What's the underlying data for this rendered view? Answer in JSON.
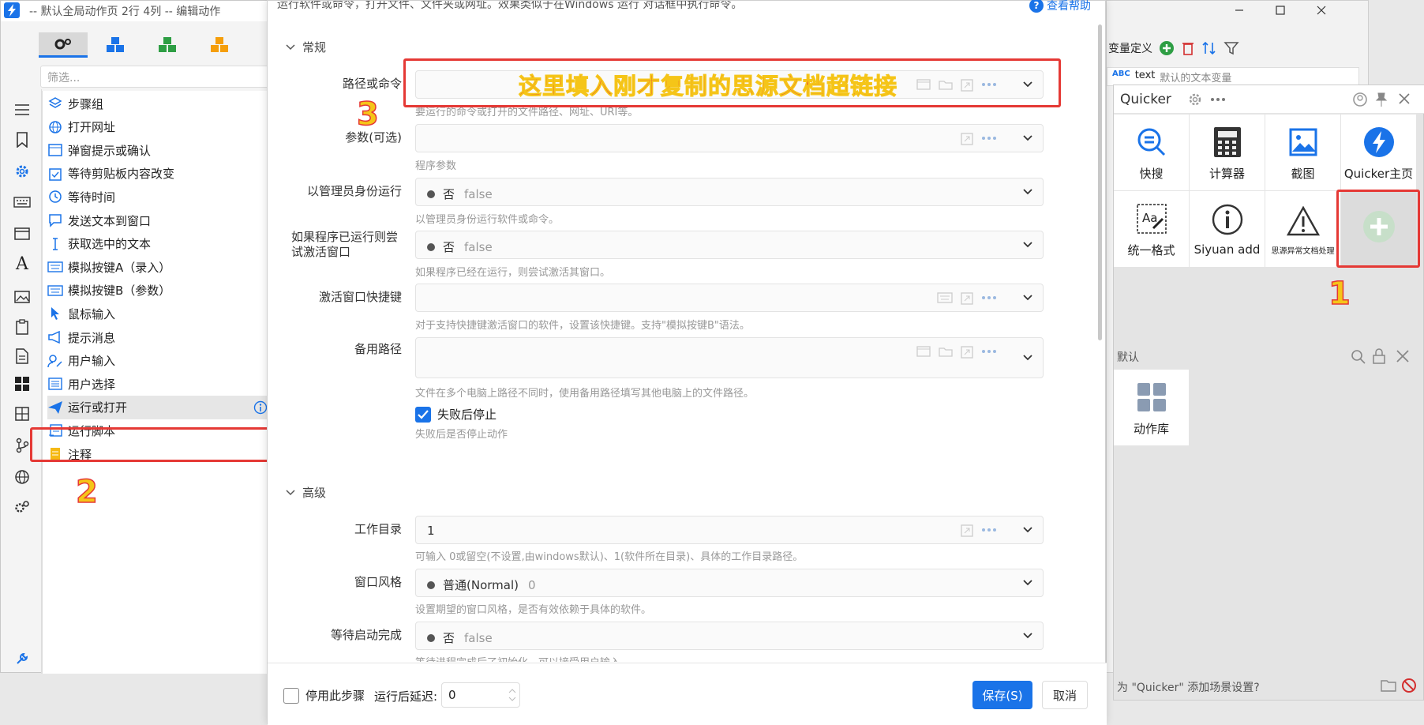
{
  "editor": {
    "title": "-- 默认全局动作页 2行 4列 -- 编辑动作",
    "filter_placeholder": "筛选...",
    "tabs": [
      "gear-icon",
      "cubes-blue-icon",
      "cubes-green-icon",
      "cubes-orange-icon"
    ],
    "steps": [
      {
        "label": "步骤组",
        "icon": "layers-icon"
      },
      {
        "label": "打开网址",
        "icon": "globe-icon"
      },
      {
        "label": "弹窗提示或确认",
        "icon": "dialog-icon"
      },
      {
        "label": "等待剪贴板内容改变",
        "icon": "clipboard-icon"
      },
      {
        "label": "等待时间",
        "icon": "clock-icon"
      },
      {
        "label": "发送文本到窗口",
        "icon": "chat-icon"
      },
      {
        "label": "获取选中的文本",
        "icon": "text-cursor-icon"
      },
      {
        "label": "模拟按键A（录入）",
        "icon": "keyboard-icon"
      },
      {
        "label": "模拟按键B（参数）",
        "icon": "keyboard-icon"
      },
      {
        "label": "鼠标输入",
        "icon": "cursor-icon"
      },
      {
        "label": "提示消息",
        "icon": "megaphone-icon"
      },
      {
        "label": "用户输入",
        "icon": "user-input-icon"
      },
      {
        "label": "用户选择",
        "icon": "list-icon"
      },
      {
        "label": "运行或打开",
        "icon": "send-icon"
      },
      {
        "label": "运行脚本",
        "icon": "script-icon"
      },
      {
        "label": "注释",
        "icon": "note-icon"
      }
    ]
  },
  "dialog": {
    "description": "运行软件或命令，打开文件、文件夹或网址。效果类似于在Windows 运行 对话框中执行命令。",
    "help_link": "查看帮助",
    "section_general": "常规",
    "section_advanced": "高级",
    "fields": {
      "path": {
        "label": "路径或命令",
        "help": "要运行的命令或打开的文件路径、网址、URI等。",
        "value": ""
      },
      "args": {
        "label": "参数(可选)",
        "help": "程序参数",
        "value": ""
      },
      "admin": {
        "label": "以管理员身份运行",
        "value": "否",
        "raw": "false",
        "help": "以管理员身份运行软件或命令。"
      },
      "activate": {
        "label": "如果程序已运行则尝试激活窗口",
        "value": "否",
        "raw": "false",
        "help": "如果程序已经在运行，则尝试激活其窗口。"
      },
      "hotkey": {
        "label": "激活窗口快捷键",
        "help": "对于支持快捷键激活窗口的软件，设置该快捷键。支持\"模拟按键B\"语法。",
        "value": ""
      },
      "altpath": {
        "label": "备用路径",
        "help": "文件在多个电脑上路径不同时，使用备用路径填写其他电脑上的文件路径。",
        "value": ""
      },
      "stop_on_fail": {
        "label": "失败后停止",
        "help": "失败后是否停止动作",
        "checked": true
      },
      "workdir": {
        "label": "工作目录",
        "value": "1",
        "help": "可输入 0或留空(不设置,由windows默认)、1(软件所在目录)、具体的工作目录路径。"
      },
      "winstyle": {
        "label": "窗口风格",
        "value": "普通(Normal)",
        "raw": "0",
        "help": "设置期望的窗口风格，是否有效依赖于具体的软件。"
      },
      "wait": {
        "label": "等待启动完成",
        "value": "否",
        "raw": "false",
        "help": "等待进程完成后了初始化，可以接受用户输入。"
      }
    },
    "footer": {
      "disable_label": "停用此步骤",
      "delay_label": "运行后延迟:",
      "delay_value": "0",
      "save": "保存(S)",
      "cancel": "取消"
    }
  },
  "annotations": {
    "path_hint": "这里填入刚才复制的思源文档超链接",
    "num1": "1",
    "num2": "2",
    "num3": "3"
  },
  "bgwin": {
    "var_def": "变量定义",
    "var_row_type": "ABC",
    "var_row_name": "text",
    "var_row_desc": "默认的文本变量"
  },
  "quicker": {
    "title": "Quicker",
    "actions": [
      {
        "label": "快搜",
        "icon": "search-icon"
      },
      {
        "label": "计算器",
        "icon": "calculator-icon"
      },
      {
        "label": "截图",
        "icon": "image-icon"
      },
      {
        "label": "Quicker主页",
        "icon": "lightning-icon"
      },
      {
        "label": "统一格式",
        "icon": "format-icon"
      },
      {
        "label": "Siyuan add",
        "icon": "info-icon"
      },
      {
        "label": "思源异常文档处理",
        "icon": "warning-icon"
      },
      {
        "label": "",
        "icon": "add-icon"
      }
    ],
    "group_label": "默认",
    "library_label": "动作库",
    "scene_prompt": "为 \"Quicker\" 添加场景设置?"
  },
  "colors": {
    "accent": "#1a73e8",
    "annotation_red": "#e53935",
    "annotation_yellow": "#f5c518"
  }
}
